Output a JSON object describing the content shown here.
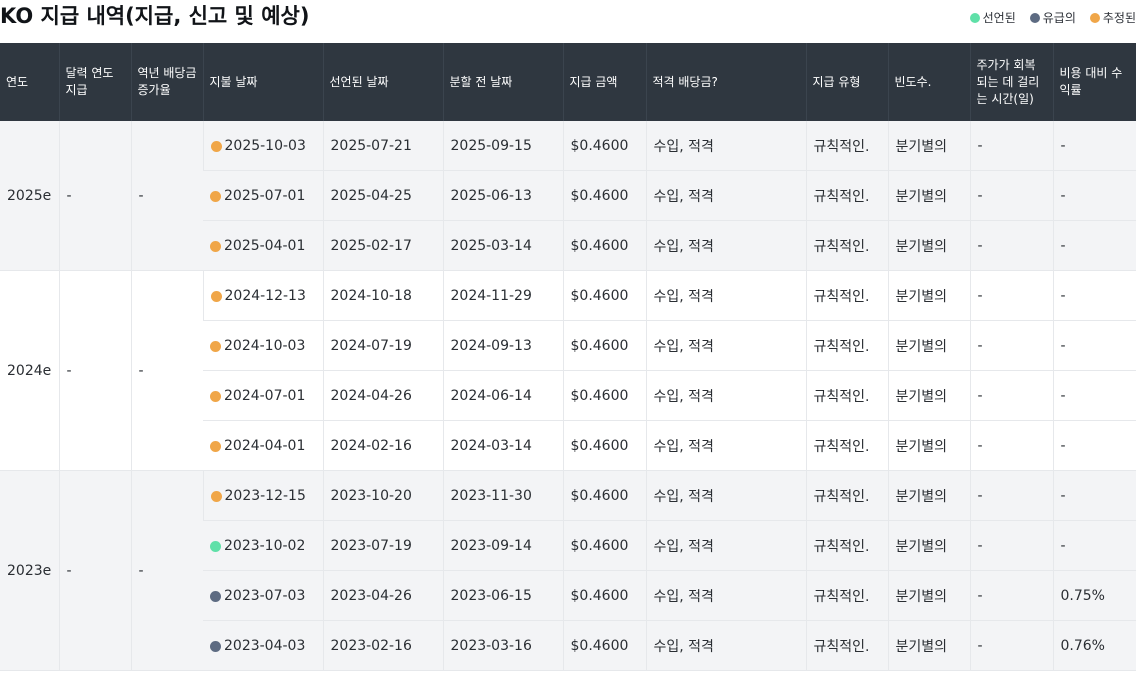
{
  "title": "KO 지급 내역(지급, 신고 및 예상)",
  "legend": [
    {
      "label": "선언된",
      "status": "declared",
      "color": "#5fe0a8"
    },
    {
      "label": "유급의",
      "status": "paid",
      "color": "#5d6b82"
    },
    {
      "label": "추정된",
      "status": "estimated",
      "color": "#f0a648"
    }
  ],
  "status_colors": {
    "declared": "#5fe0a8",
    "paid": "#5d6b82",
    "estimated": "#f0a648"
  },
  "columns": [
    "연도",
    "달력 연도 지급",
    "역년 배당금 증가율",
    "지불 날짜",
    "선언된 날짜",
    "분할 전 날짜",
    "지급 금액",
    "적격 배당금?",
    "지급 유형",
    "빈도수.",
    "주가가 회복되는 데 걸리는 시간(일)",
    "비용 대비 수익률"
  ],
  "groups": [
    {
      "year": "2025e",
      "calendar_payment": "-",
      "growth": "-",
      "rows": [
        {
          "status": "estimated",
          "pay_date": "2025-10-03",
          "declared_date": "2025-07-21",
          "ex_date": "2025-09-15",
          "amount": "$0.4600",
          "qualified": "수입, 적격",
          "type": "규칙적인.",
          "frequency": "분기별의",
          "recovery_days": "-",
          "yield_on_cost": "-"
        },
        {
          "status": "estimated",
          "pay_date": "2025-07-01",
          "declared_date": "2025-04-25",
          "ex_date": "2025-06-13",
          "amount": "$0.4600",
          "qualified": "수입, 적격",
          "type": "규칙적인.",
          "frequency": "분기별의",
          "recovery_days": "-",
          "yield_on_cost": "-"
        },
        {
          "status": "estimated",
          "pay_date": "2025-04-01",
          "declared_date": "2025-02-17",
          "ex_date": "2025-03-14",
          "amount": "$0.4600",
          "qualified": "수입, 적격",
          "type": "규칙적인.",
          "frequency": "분기별의",
          "recovery_days": "-",
          "yield_on_cost": "-"
        }
      ]
    },
    {
      "year": "2024e",
      "calendar_payment": "-",
      "growth": "-",
      "rows": [
        {
          "status": "estimated",
          "pay_date": "2024-12-13",
          "declared_date": "2024-10-18",
          "ex_date": "2024-11-29",
          "amount": "$0.4600",
          "qualified": "수입, 적격",
          "type": "규칙적인.",
          "frequency": "분기별의",
          "recovery_days": "-",
          "yield_on_cost": "-"
        },
        {
          "status": "estimated",
          "pay_date": "2024-10-03",
          "declared_date": "2024-07-19",
          "ex_date": "2024-09-13",
          "amount": "$0.4600",
          "qualified": "수입, 적격",
          "type": "규칙적인.",
          "frequency": "분기별의",
          "recovery_days": "-",
          "yield_on_cost": "-"
        },
        {
          "status": "estimated",
          "pay_date": "2024-07-01",
          "declared_date": "2024-04-26",
          "ex_date": "2024-06-14",
          "amount": "$0.4600",
          "qualified": "수입, 적격",
          "type": "규칙적인.",
          "frequency": "분기별의",
          "recovery_days": "-",
          "yield_on_cost": "-"
        },
        {
          "status": "estimated",
          "pay_date": "2024-04-01",
          "declared_date": "2024-02-16",
          "ex_date": "2024-03-14",
          "amount": "$0.4600",
          "qualified": "수입, 적격",
          "type": "규칙적인.",
          "frequency": "분기별의",
          "recovery_days": "-",
          "yield_on_cost": "-"
        }
      ]
    },
    {
      "year": "2023e",
      "calendar_payment": "-",
      "growth": "-",
      "rows": [
        {
          "status": "estimated",
          "pay_date": "2023-12-15",
          "declared_date": "2023-10-20",
          "ex_date": "2023-11-30",
          "amount": "$0.4600",
          "qualified": "수입, 적격",
          "type": "규칙적인.",
          "frequency": "분기별의",
          "recovery_days": "-",
          "yield_on_cost": "-"
        },
        {
          "status": "declared",
          "pay_date": "2023-10-02",
          "declared_date": "2023-07-19",
          "ex_date": "2023-09-14",
          "amount": "$0.4600",
          "qualified": "수입, 적격",
          "type": "규칙적인.",
          "frequency": "분기별의",
          "recovery_days": "-",
          "yield_on_cost": "-"
        },
        {
          "status": "paid",
          "pay_date": "2023-07-03",
          "declared_date": "2023-04-26",
          "ex_date": "2023-06-15",
          "amount": "$0.4600",
          "qualified": "수입, 적격",
          "type": "규칙적인.",
          "frequency": "분기별의",
          "recovery_days": "-",
          "yield_on_cost": "0.75%"
        },
        {
          "status": "paid",
          "pay_date": "2023-04-03",
          "declared_date": "2023-02-16",
          "ex_date": "2023-03-16",
          "amount": "$0.4600",
          "qualified": "수입, 적격",
          "type": "규칙적인.",
          "frequency": "분기별의",
          "recovery_days": "-",
          "yield_on_cost": "0.76%"
        }
      ]
    }
  ]
}
